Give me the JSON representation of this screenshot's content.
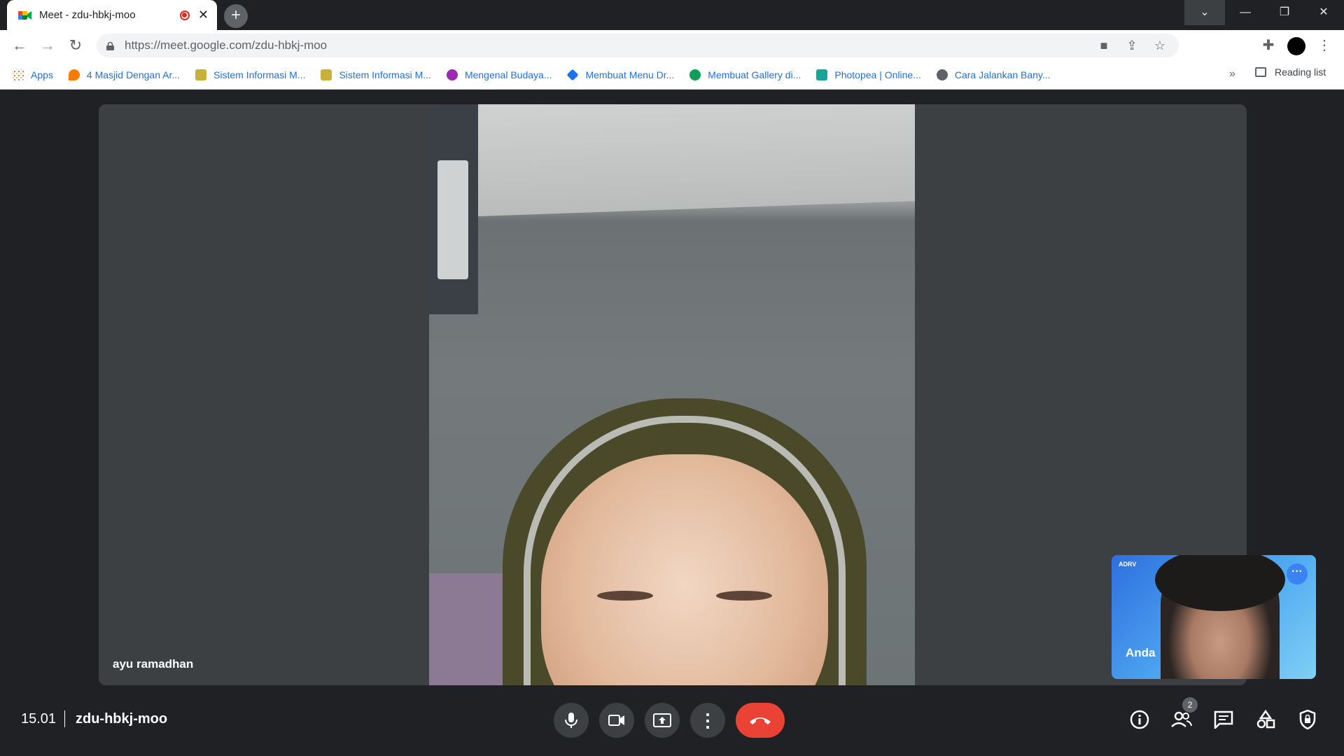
{
  "browser": {
    "tab_title": "Meet - zdu-hbkj-moo",
    "new_tab": "+",
    "url": "https://meet.google.com/zdu-hbkj-moo",
    "bookmarks": [
      {
        "label": "Apps",
        "icon": "apps-grid-icon",
        "color": "#ea4335"
      },
      {
        "label": "4 Masjid Dengan Ar...",
        "icon": "map-pin-icon",
        "color": "#f57c00"
      },
      {
        "label": "Sistem Informasi M...",
        "icon": "site-icon",
        "color": "#c9b03a"
      },
      {
        "label": "Sistem Informasi M...",
        "icon": "site-icon",
        "color": "#c9b03a"
      },
      {
        "label": "Mengenal Budaya...",
        "icon": "site-icon",
        "color": "#9c27b0"
      },
      {
        "label": "Membuat Menu Dr...",
        "icon": "code-icon",
        "color": "#1a73e8"
      },
      {
        "label": "Membuat Gallery di...",
        "icon": "site-icon",
        "color": "#0f9d58"
      },
      {
        "label": "Photopea | Online...",
        "icon": "photopea-icon",
        "color": "#18a497"
      },
      {
        "label": "Cara Jalankan Bany...",
        "icon": "globe-icon",
        "color": "#5f6368"
      }
    ],
    "bookmarks_more": "»",
    "reading_list": "Reading list"
  },
  "meeting": {
    "participant_name": "ayu ramadhan",
    "self_name": "Anda",
    "self_brand": "ADRV",
    "time": "15.01",
    "code": "zdu-hbkj-moo",
    "participant_count": "2"
  },
  "colors": {
    "end_call": "#ea4335",
    "background": "#202124",
    "tile": "#3c4043"
  }
}
